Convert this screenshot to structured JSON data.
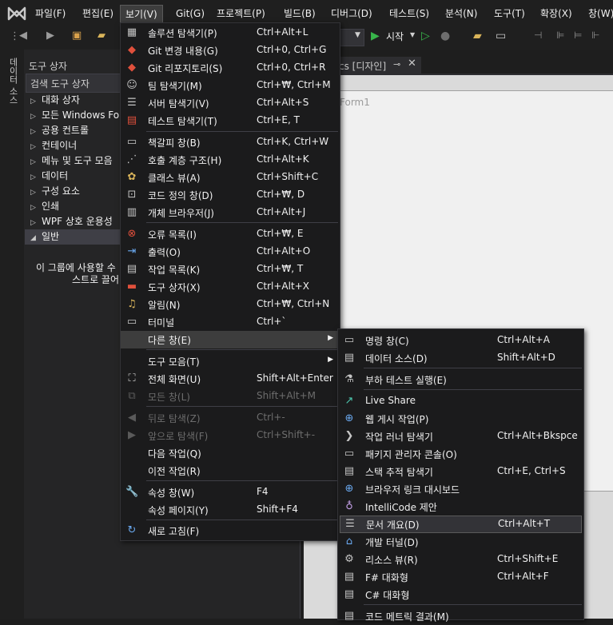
{
  "menubar": {
    "items": [
      "파일(F)",
      "편집(E)",
      "보기(V)",
      "Git(G)",
      "프로젝트(P)",
      "빌드(B)",
      "디버그(D)",
      "테스트(S)",
      "분석(N)",
      "도구(T)",
      "확장(X)",
      "창(W)"
    ]
  },
  "toolbar": {
    "start_label": "시작"
  },
  "left_tabs": {
    "data_sources": "데이터 소스"
  },
  "toolbox": {
    "title": "도구 상자",
    "search_placeholder": "검색 도구 상자",
    "categories": [
      "대화 상자",
      "모든 Windows Forms",
      "공용 컨트롤",
      "컨테이너",
      "메뉴 및 도구 모음",
      "데이터",
      "구성 요소",
      "인쇄",
      "WPF 상호 운용성",
      "일반"
    ],
    "empty_line1": "이 그룹에 사용할 수",
    "empty_line2": "스트로 끌어"
  },
  "editor": {
    "tab_label": "cs [디자인]",
    "form_title": "Form1"
  },
  "view_menu": {
    "items": [
      {
        "label": "솔루션 탐색기(P)",
        "shortcut": "Ctrl+Alt+L",
        "icon": "solution-explorer-icon"
      },
      {
        "label": "Git 변경 내용(G)",
        "shortcut": "Ctrl+0, Ctrl+G",
        "icon": "git-changes-icon"
      },
      {
        "label": "Git 리포지토리(S)",
        "shortcut": "Ctrl+0, Ctrl+R",
        "icon": "git-repository-icon"
      },
      {
        "label": "팀 탐색기(M)",
        "shortcut": "Ctrl+₩, Ctrl+M",
        "icon": "team-explorer-icon"
      },
      {
        "label": "서버 탐색기(V)",
        "shortcut": "Ctrl+Alt+S",
        "icon": "server-explorer-icon"
      },
      {
        "label": "테스트 탐색기(T)",
        "shortcut": "Ctrl+E, T",
        "icon": "test-explorer-icon"
      },
      {
        "label": "책갈피 창(B)",
        "shortcut": "Ctrl+K, Ctrl+W",
        "icon": "bookmark-icon"
      },
      {
        "label": "호출 계층 구조(H)",
        "shortcut": "Ctrl+Alt+K",
        "icon": "call-hierarchy-icon"
      },
      {
        "label": "클래스 뷰(A)",
        "shortcut": "Ctrl+Shift+C",
        "icon": "class-view-icon"
      },
      {
        "label": "코드 정의 창(D)",
        "shortcut": "Ctrl+₩, D",
        "icon": "code-definition-icon"
      },
      {
        "label": "개체 브라우저(J)",
        "shortcut": "Ctrl+Alt+J",
        "icon": "object-browser-icon"
      },
      {
        "label": "오류 목록(I)",
        "shortcut": "Ctrl+₩, E",
        "icon": "error-list-icon"
      },
      {
        "label": "출력(O)",
        "shortcut": "Ctrl+Alt+O",
        "icon": "output-icon"
      },
      {
        "label": "작업 목록(K)",
        "shortcut": "Ctrl+₩, T",
        "icon": "task-list-icon"
      },
      {
        "label": "도구 상자(X)",
        "shortcut": "Ctrl+Alt+X",
        "icon": "toolbox-icon"
      },
      {
        "label": "알림(N)",
        "shortcut": "Ctrl+₩, Ctrl+N",
        "icon": "notification-bell-icon"
      },
      {
        "label": "터미널",
        "shortcut": "Ctrl+`",
        "icon": "terminal-icon"
      },
      {
        "label": "다른 창(E)",
        "shortcut": "",
        "icon": ""
      },
      {
        "label": "도구 모음(T)",
        "shortcut": "",
        "icon": ""
      },
      {
        "label": "전체 화면(U)",
        "shortcut": "Shift+Alt+Enter",
        "icon": "fullscreen-icon"
      },
      {
        "label": "모든 창(L)",
        "shortcut": "Shift+Alt+M",
        "icon": "all-windows-icon"
      },
      {
        "label": "뒤로 탐색(Z)",
        "shortcut": "Ctrl+-",
        "icon": "navigate-back-icon"
      },
      {
        "label": "앞으로 탐색(F)",
        "shortcut": "Ctrl+Shift+-",
        "icon": "navigate-forward-icon"
      },
      {
        "label": "다음 작업(Q)",
        "shortcut": "",
        "icon": ""
      },
      {
        "label": "이전 작업(R)",
        "shortcut": "",
        "icon": ""
      },
      {
        "label": "속성 창(W)",
        "shortcut": "F4",
        "icon": "wrench-icon"
      },
      {
        "label": "속성 페이지(Y)",
        "shortcut": "Shift+F4",
        "icon": ""
      },
      {
        "label": "새로 고침(F)",
        "shortcut": "",
        "icon": "refresh-icon"
      }
    ]
  },
  "other_windows_menu": {
    "items": [
      {
        "label": "명령 창(C)",
        "shortcut": "Ctrl+Alt+A",
        "icon": "command-window-icon"
      },
      {
        "label": "데이터 소스(D)",
        "shortcut": "Shift+Alt+D",
        "icon": "data-sources-icon"
      },
      {
        "label": "부하 테스트 실행(E)",
        "shortcut": "",
        "icon": "load-test-icon"
      },
      {
        "label": "Live Share",
        "shortcut": "",
        "icon": "live-share-icon"
      },
      {
        "label": "웹 게시 작업(P)",
        "shortcut": "",
        "icon": "web-publish-icon"
      },
      {
        "label": "작업 러너 탐색기",
        "shortcut": "Ctrl+Alt+Bkspce",
        "icon": "task-runner-icon"
      },
      {
        "label": "패키지 관리자 콘솔(O)",
        "shortcut": "",
        "icon": "package-manager-icon"
      },
      {
        "label": "스택 추적 탐색기",
        "shortcut": "Ctrl+E, Ctrl+S",
        "icon": "stack-trace-icon"
      },
      {
        "label": "브라우저 링크 대시보드",
        "shortcut": "",
        "icon": "browser-link-icon"
      },
      {
        "label": "IntelliCode 제안",
        "shortcut": "",
        "icon": "intellicode-icon"
      },
      {
        "label": "문서 개요(D)",
        "shortcut": "Ctrl+Alt+T",
        "icon": "document-outline-icon"
      },
      {
        "label": "개발 터널(D)",
        "shortcut": "",
        "icon": "dev-tunnel-icon"
      },
      {
        "label": "리소스 뷰(R)",
        "shortcut": "Ctrl+Shift+E",
        "icon": "resource-view-icon"
      },
      {
        "label": "F# 대화형",
        "shortcut": "Ctrl+Alt+F",
        "icon": "fsharp-interactive-icon"
      },
      {
        "label": "C# 대화형",
        "shortcut": "",
        "icon": "csharp-interactive-icon"
      },
      {
        "label": "코드 메트릭 결과(M)",
        "shortcut": "",
        "icon": "code-metrics-icon"
      }
    ]
  }
}
